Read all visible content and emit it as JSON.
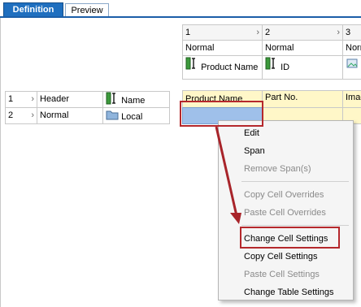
{
  "tabs": [
    {
      "label": "Definition",
      "active": true
    },
    {
      "label": "Preview",
      "active": false
    }
  ],
  "columns": {
    "numbers": [
      "1",
      "2",
      "3"
    ],
    "modes": [
      "Normal",
      "Normal",
      "Norm"
    ],
    "fields": [
      "Product Name",
      "ID"
    ]
  },
  "rows": [
    {
      "number": "1",
      "mode": "Header",
      "field": "Name"
    },
    {
      "number": "2",
      "mode": "Normal",
      "field": "Local"
    }
  ],
  "grid": {
    "header_cells": [
      "Product Name",
      "Part No.",
      "Imag"
    ]
  },
  "context_menu": {
    "items": [
      {
        "label": "Edit",
        "enabled": true
      },
      {
        "label": "Span",
        "enabled": true
      },
      {
        "label": "Remove Span(s)",
        "enabled": false
      },
      {
        "label": "Copy Cell Overrides",
        "enabled": false
      },
      {
        "label": "Paste Cell Overrides",
        "enabled": false
      },
      {
        "label": "Change Cell Settings",
        "enabled": true
      },
      {
        "label": "Copy Cell Settings",
        "enabled": true
      },
      {
        "label": "Paste Cell Settings",
        "enabled": false
      },
      {
        "label": "Change Table Settings",
        "enabled": true
      }
    ]
  },
  "colors": {
    "accent": "#1f6fbf",
    "highlight": "#b5282c",
    "selected_cell": "#9fc0ea",
    "header_row": "#fff7c8"
  }
}
